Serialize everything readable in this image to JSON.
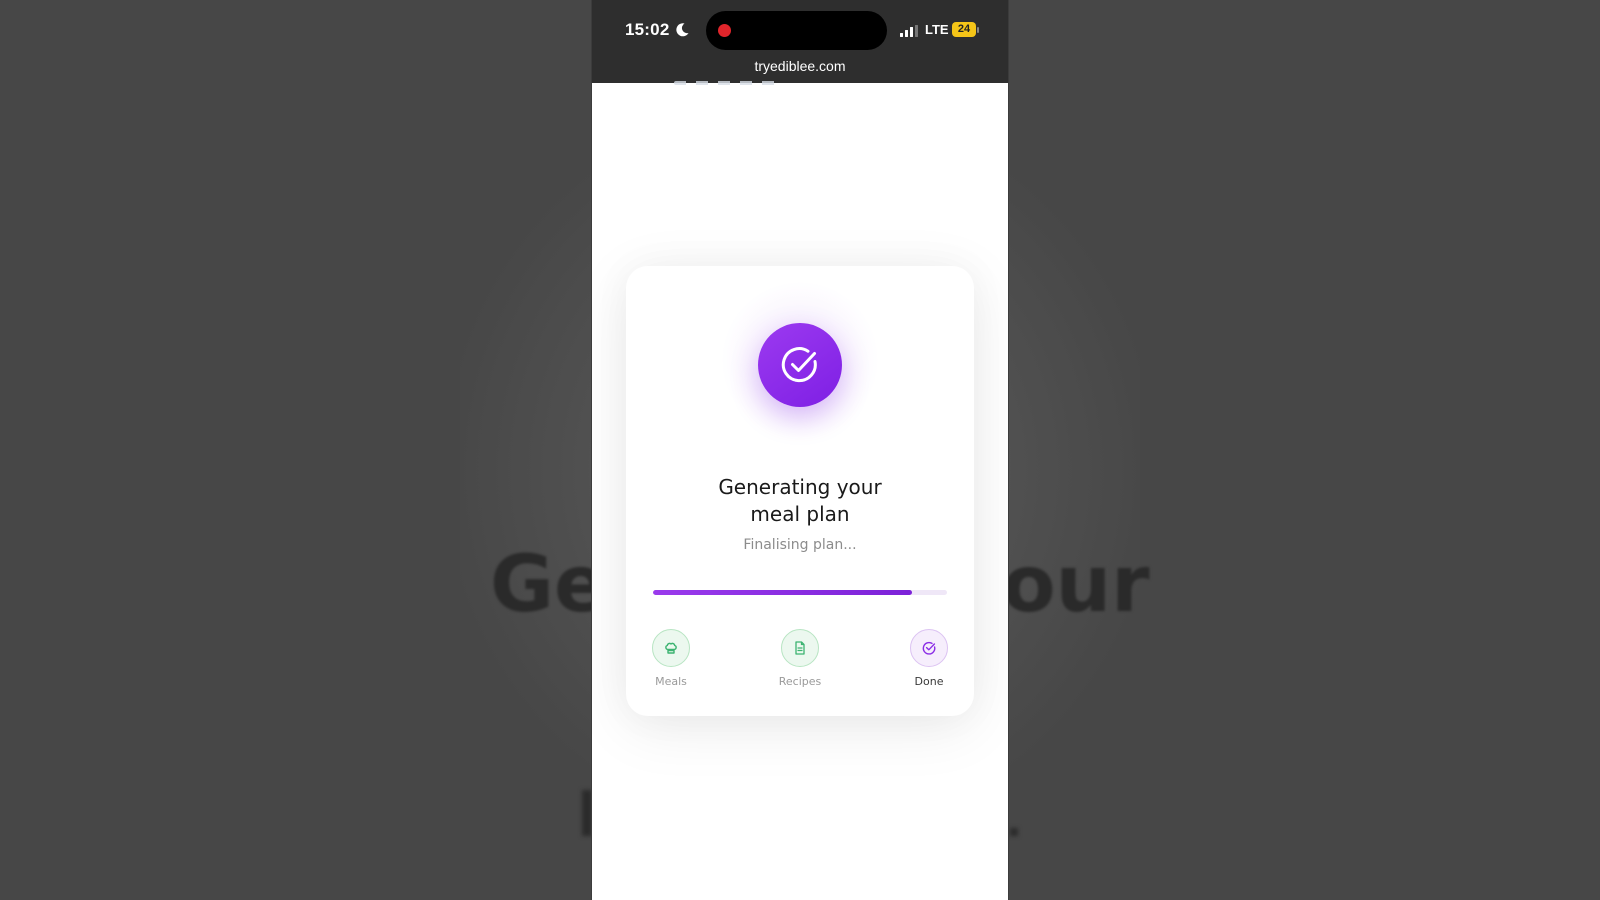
{
  "background": {
    "heading_left": "Ge",
    "heading_right": "our"
  },
  "status_bar": {
    "time": "15:02",
    "network": "LTE",
    "battery": "24"
  },
  "browser": {
    "url": "tryediblee.com"
  },
  "card": {
    "title": "Generating your meal plan",
    "subtitle": "Finalising plan...",
    "progress_fraction": 0.88,
    "colors": {
      "accent": "#8b2ee6",
      "step_done": "#3cb371",
      "step_active": "#8b2ee6"
    },
    "steps": [
      {
        "label": "Meals",
        "icon": "chef-hat-icon",
        "state": "done"
      },
      {
        "label": "Recipes",
        "icon": "document-icon",
        "state": "done"
      },
      {
        "label": "Done",
        "icon": "check-circle-icon",
        "state": "active"
      }
    ]
  }
}
